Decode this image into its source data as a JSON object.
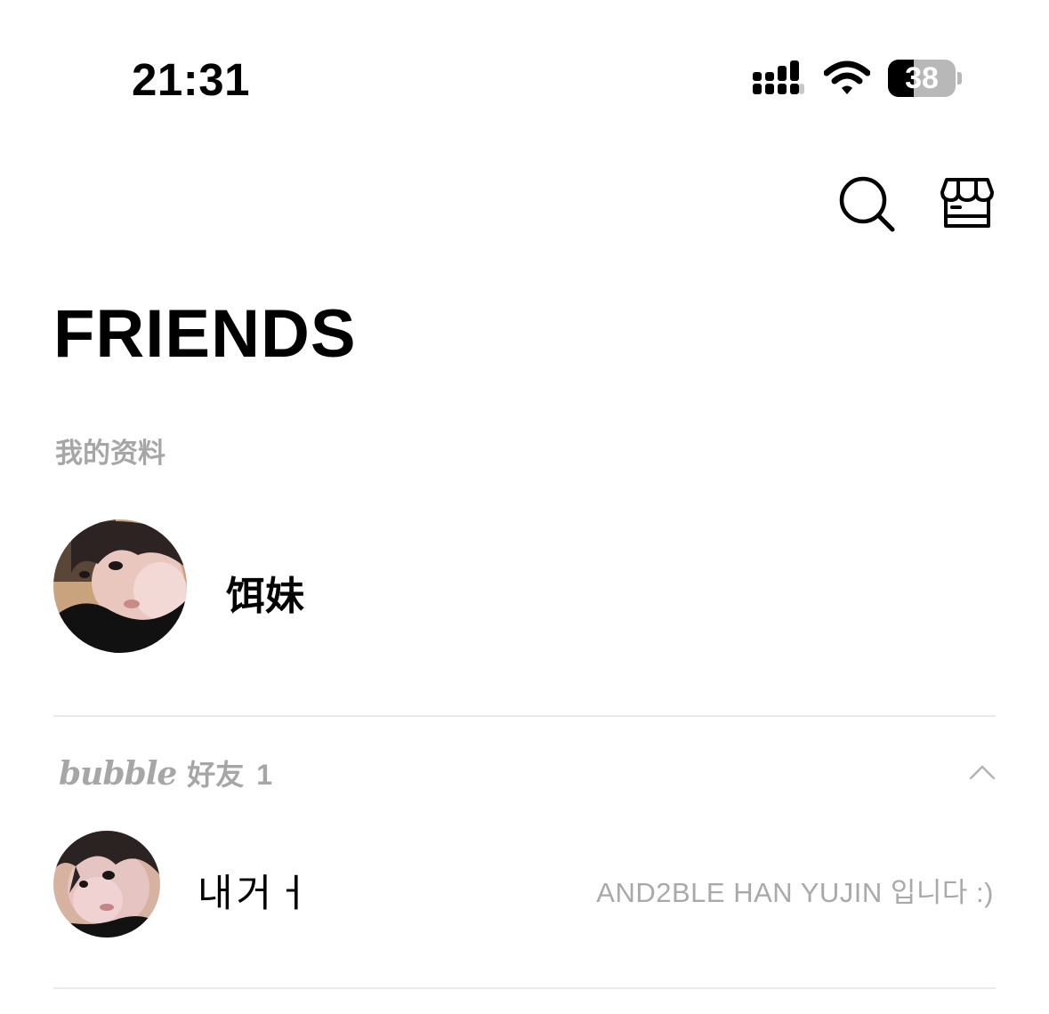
{
  "status_bar": {
    "time": "21:31",
    "battery_percent": 38,
    "battery_label": "38",
    "signal_icon": "cellular-signal-icon",
    "wifi_icon": "wifi-icon"
  },
  "header": {
    "search_icon": "search-icon",
    "store_icon": "store-icon",
    "title": "FRIENDS"
  },
  "profile": {
    "section_label": "我的资料",
    "name": "饵妹"
  },
  "bubble": {
    "logo": "bubble",
    "label": "好友",
    "count": "1",
    "collapse_icon": "chevron-up-icon"
  },
  "friends": [
    {
      "name": "내거ㅓ",
      "status": "AND2BLE HAN YUJIN 입니다 :)"
    }
  ],
  "colors": {
    "text_primary": "#000000",
    "text_secondary": "#a6a6a6",
    "divider": "#e9e9e9",
    "battery_track": "#b8b8b8"
  }
}
